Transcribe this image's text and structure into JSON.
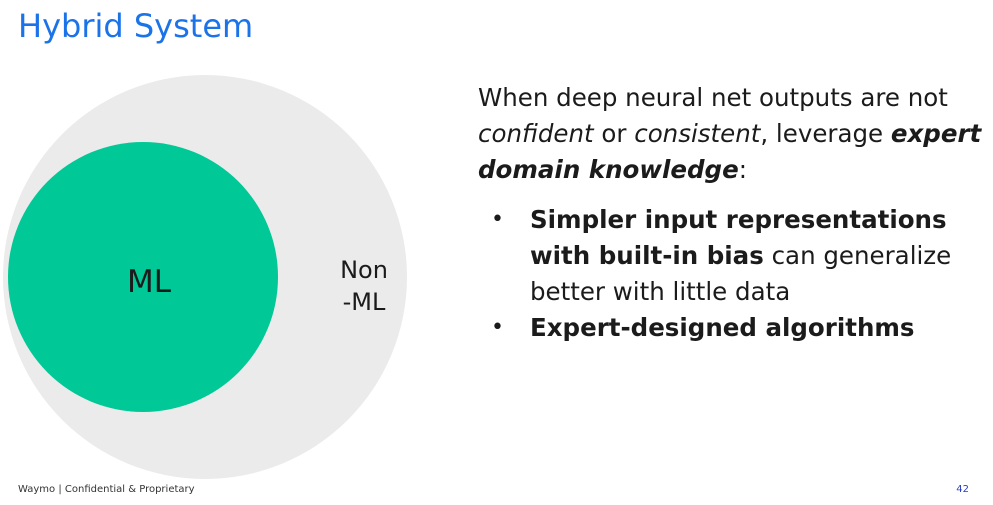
{
  "colors": {
    "title": "#1a73e8",
    "ml_circle": "#00c896",
    "outer_circle": "#ebebeb",
    "text": "#1b1b1b",
    "page_number": "#2a3fbd"
  },
  "slide": {
    "title": "Hybrid System",
    "diagram": {
      "inner_label": "ML",
      "outer_label_line1": "Non",
      "outer_label_line2": "-ML"
    },
    "intro": {
      "t1": "When deep neural net outputs are not ",
      "t2": "confident",
      "t3": " or ",
      "t4": "consistent",
      "t5": ", leverage ",
      "t6": "expert domain knowledge",
      "t7": ":"
    },
    "bullets": [
      {
        "marker": "•",
        "bold": "Simpler input representations with built-in bias",
        "rest": " can generalize better with little data"
      },
      {
        "marker": "•",
        "bold": "Expert-designed algorithms",
        "rest": ""
      }
    ],
    "footer": "Waymo | Confidential & Proprietary",
    "page_number": "42"
  }
}
